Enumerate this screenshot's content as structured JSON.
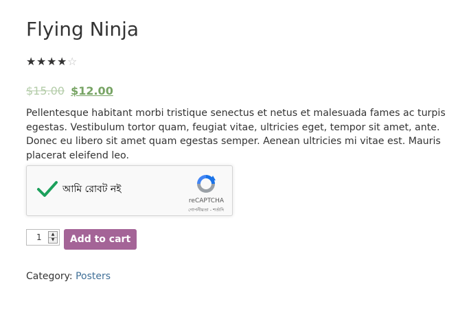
{
  "product": {
    "title": "Flying Ninja",
    "rating": {
      "value": 4,
      "max": 5
    },
    "price": {
      "regular": "$15.00",
      "sale": "$12.00"
    },
    "description": "Pellentesque habitant morbi tristique senectus et netus et malesuada fames ac turpis egestas. Vestibulum tortor quam, feugiat vitae, ultricies eget, tempor sit amet, ante. Donec eu libero sit amet quam egestas semper. Aenean ultricies mi vitae est. Mauris placerat eleifend leo."
  },
  "captcha": {
    "checked": true,
    "label": "আমি রোবট নই",
    "brand": "reCAPTCHA",
    "links": "গোপনীয়তা - শর্তাদি"
  },
  "cart": {
    "quantity": "1",
    "add_label": "Add to cart"
  },
  "meta": {
    "category_label": "Category:",
    "category_value": "Posters"
  },
  "colors": {
    "accent_button": "#a46497",
    "price_green": "#77a464",
    "link_blue": "#3f6f97"
  }
}
